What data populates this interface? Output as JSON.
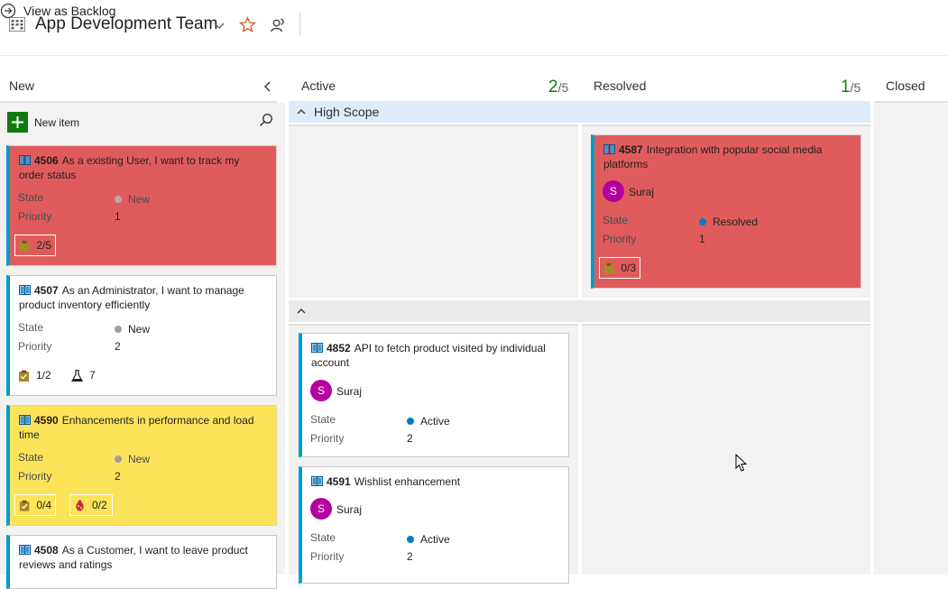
{
  "header": {
    "team_title": "App Development Team",
    "view_backlog_label": "View as Backlog"
  },
  "columns": [
    {
      "title": "New"
    },
    {
      "title": "Active",
      "count_current": "2",
      "count_limit": "/5"
    },
    {
      "title": "Resolved",
      "count_current": "1",
      "count_limit": "/5"
    },
    {
      "title": "Closed"
    }
  ],
  "new_item_label": "New item",
  "swimlanes": [
    {
      "title": "High Scope"
    },
    {
      "title": ""
    }
  ],
  "field_labels": {
    "state": "State",
    "priority": "Priority"
  },
  "cards": {
    "c4506": {
      "id": "4506",
      "title": "As a existing User, I want to track my order status",
      "state": "New",
      "priority": "1",
      "tasks": "2/5"
    },
    "c4507": {
      "id": "4507",
      "title": "As an Administrator, I want to manage product inventory efficiently",
      "state": "New",
      "priority": "2",
      "tasks": "1/2",
      "tests": "7"
    },
    "c4590": {
      "id": "4590",
      "title": "Enhancements in performance and load time",
      "state": "New",
      "priority": "2",
      "tasks": "0/4",
      "bugs": "0/2"
    },
    "c4508": {
      "id": "4508",
      "title": "As a Customer, I want to leave product reviews and ratings"
    },
    "c4587": {
      "id": "4587",
      "title": "Integration with popular social media platforms",
      "assignee": "Suraj",
      "avatar_initial": "S",
      "state": "Resolved",
      "priority": "1",
      "tasks": "0/3"
    },
    "c4852": {
      "id": "4852",
      "title": "API to fetch product visited by individual account",
      "assignee": "Suraj",
      "avatar_initial": "S",
      "state": "Active",
      "priority": "2"
    },
    "c4591": {
      "id": "4591",
      "title": "Wishlist enhancement",
      "assignee": "Suraj",
      "avatar_initial": "S",
      "state": "Active",
      "priority": "2"
    }
  },
  "colors": {
    "state_new": "#a19f9d",
    "state_active": "#007acc",
    "state_resolved": "#007acc",
    "card_red": "#e05c5c",
    "card_yellow": "#fce45a",
    "accent_green": "#107c10",
    "avatar": "#b4009e"
  }
}
